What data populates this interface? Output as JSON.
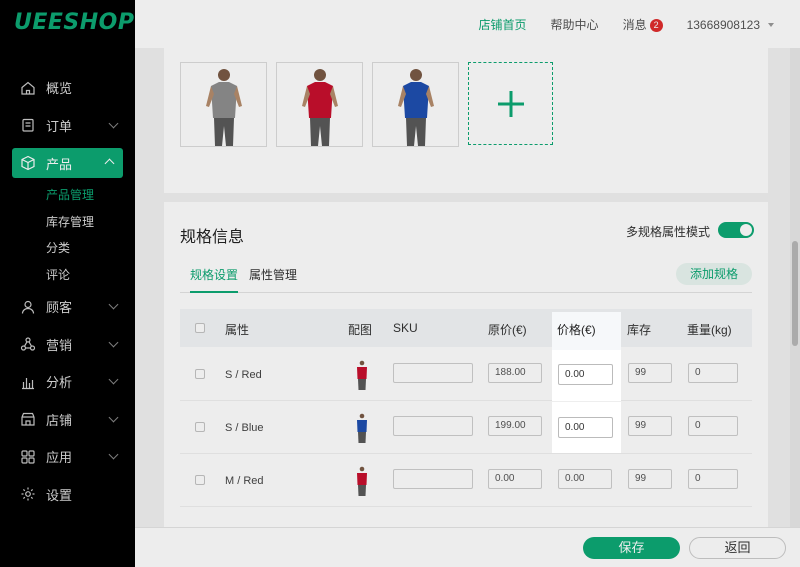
{
  "brand": {
    "logo_text": "UEESHOP",
    "accent": "#0da875"
  },
  "header": {
    "home_link": "店铺首页",
    "help_link": "帮助中心",
    "messages_link": "消息",
    "messages_count": "2",
    "user_phone": "13668908123"
  },
  "sidebar": {
    "items": [
      {
        "label": "概览",
        "icon": "home-icon"
      },
      {
        "label": "订单",
        "icon": "order-icon"
      },
      {
        "label": "产品",
        "icon": "box-icon"
      },
      {
        "label": "顾客",
        "icon": "user-icon"
      },
      {
        "label": "营销",
        "icon": "marketing-icon"
      },
      {
        "label": "分析",
        "icon": "chart-icon"
      },
      {
        "label": "店铺",
        "icon": "store-icon"
      },
      {
        "label": "应用",
        "icon": "apps-icon"
      },
      {
        "label": "设置",
        "icon": "gear-icon"
      }
    ],
    "sub_items": [
      "产品管理",
      "库存管理",
      "分类",
      "评论"
    ]
  },
  "images": {
    "thumbnails": [
      "gray-tshirt",
      "red-tshirt",
      "blue-tshirt"
    ],
    "add_label": "+"
  },
  "spec": {
    "title": "规格信息",
    "mode_label": "多规格属性模式",
    "tabs": [
      "规格设置",
      "属性管理"
    ],
    "add_button": "添加规格",
    "columns": {
      "attr": "属性",
      "image": "配图",
      "sku": "SKU",
      "orig_price": "原价(€)",
      "price": "价格(€)",
      "stock": "库存",
      "weight": "重量(kg)"
    },
    "rows": [
      {
        "attr": "S / Red",
        "color": "#c8102e",
        "sku": "",
        "orig_price": "188.00",
        "price": "0.00",
        "stock": "99",
        "weight": "0"
      },
      {
        "attr": "S / Blue",
        "color": "#1f4fb0",
        "sku": "",
        "orig_price": "199.00",
        "price": "0.00",
        "stock": "99",
        "weight": "0"
      },
      {
        "attr": "M / Red",
        "color": "#c8102e",
        "sku": "",
        "orig_price": "0.00",
        "price": "0.00",
        "stock": "99",
        "weight": "0"
      }
    ]
  },
  "footer": {
    "save": "保存",
    "back": "返回"
  }
}
